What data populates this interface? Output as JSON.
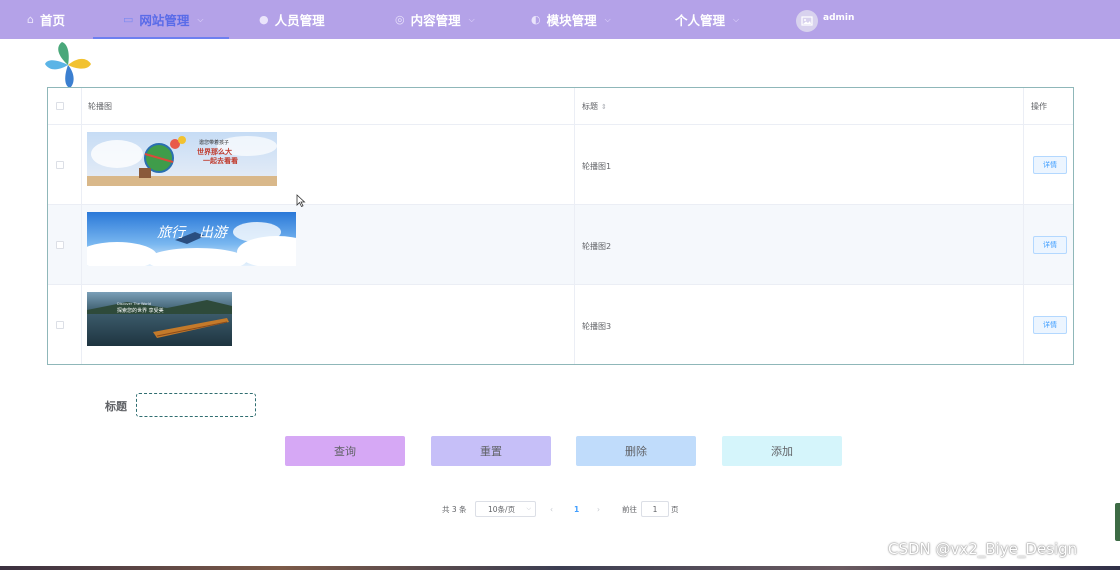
{
  "nav": {
    "items": [
      {
        "label": "首页",
        "icon": "home-icon",
        "has_dropdown": false
      },
      {
        "label": "网站管理",
        "icon": "monitor-icon",
        "has_dropdown": true,
        "active": true
      },
      {
        "label": "人员管理",
        "icon": "user-icon",
        "has_dropdown": false
      },
      {
        "label": "内容管理",
        "icon": "content-icon",
        "has_dropdown": true
      },
      {
        "label": "模块管理",
        "icon": "module-icon",
        "has_dropdown": true
      },
      {
        "label": "个人管理",
        "icon": "",
        "has_dropdown": true
      }
    ],
    "user": "admin",
    "color": "#b4a2e8",
    "active_color": "#5a6be8"
  },
  "table": {
    "columns": [
      "轮播图",
      "标题",
      "操作"
    ],
    "rows": [
      {
        "title": "轮播图1",
        "action": "详情",
        "banner_text": [
          "邀您带着孩子",
          "世界那么大",
          "一起去看看"
        ]
      },
      {
        "title": "轮播图2",
        "action": "详情",
        "banner_text": [
          "旅行",
          "出游"
        ]
      },
      {
        "title": "轮播图3",
        "action": "详情",
        "banner_text": [
          "Discover The World",
          "探索您的世界 享受美"
        ]
      }
    ]
  },
  "search": {
    "label": "标题",
    "value": ""
  },
  "buttons": {
    "query": "查询",
    "reset": "重置",
    "delete": "删除",
    "add": "添加"
  },
  "pagination": {
    "total": "共 3 条",
    "page_size": "10条/页",
    "current": "1",
    "goto_label": "前往",
    "goto_value": "1",
    "page_suffix": "页"
  },
  "watermark": "CSDN @vx2_Biye_Design"
}
